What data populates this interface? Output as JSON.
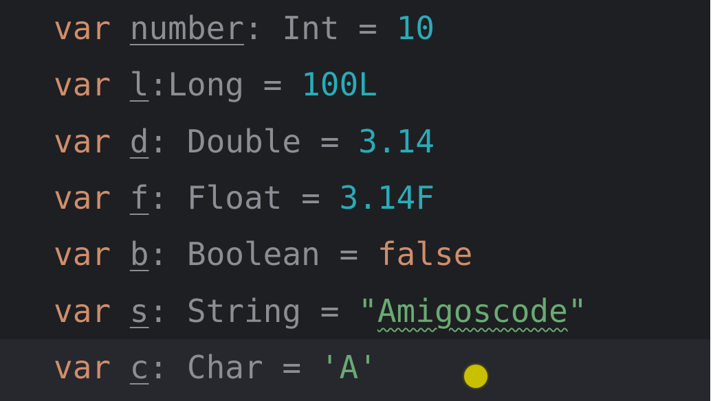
{
  "editor": {
    "lines": [
      {
        "keyword": "var",
        "name": "number",
        "sep": ": ",
        "type": "Int",
        "op": " = ",
        "value": "10"
      },
      {
        "keyword": "var",
        "name": "l",
        "sep": ":",
        "type": "Long",
        "op": " = ",
        "value": "100L"
      },
      {
        "keyword": "var",
        "name": "d",
        "sep": ": ",
        "type": "Double",
        "op": " = ",
        "value": "3.14"
      },
      {
        "keyword": "var",
        "name": "f",
        "sep": ": ",
        "type": "Float",
        "op": " = ",
        "value": "3.14F"
      },
      {
        "keyword": "var",
        "name": "b",
        "sep": ": ",
        "type": "Boolean",
        "op": " = ",
        "value": "false"
      },
      {
        "keyword": "var",
        "name": "s",
        "sep": ": ",
        "type": "String",
        "op": " = ",
        "quote_open": "\"",
        "value": "Amigoscode",
        "quote_close": "\""
      },
      {
        "keyword": "var",
        "name": "c",
        "sep": ": ",
        "type": "Char",
        "op": " = ",
        "value": "'A'"
      }
    ]
  },
  "colors": {
    "background": "#1e1f22",
    "current_line": "#26282e",
    "keyword": "#cf8e6d",
    "identifier": "#8b8e94",
    "number": "#2aacb8",
    "string": "#6aab73",
    "cursor_highlight": "#c8c000"
  }
}
